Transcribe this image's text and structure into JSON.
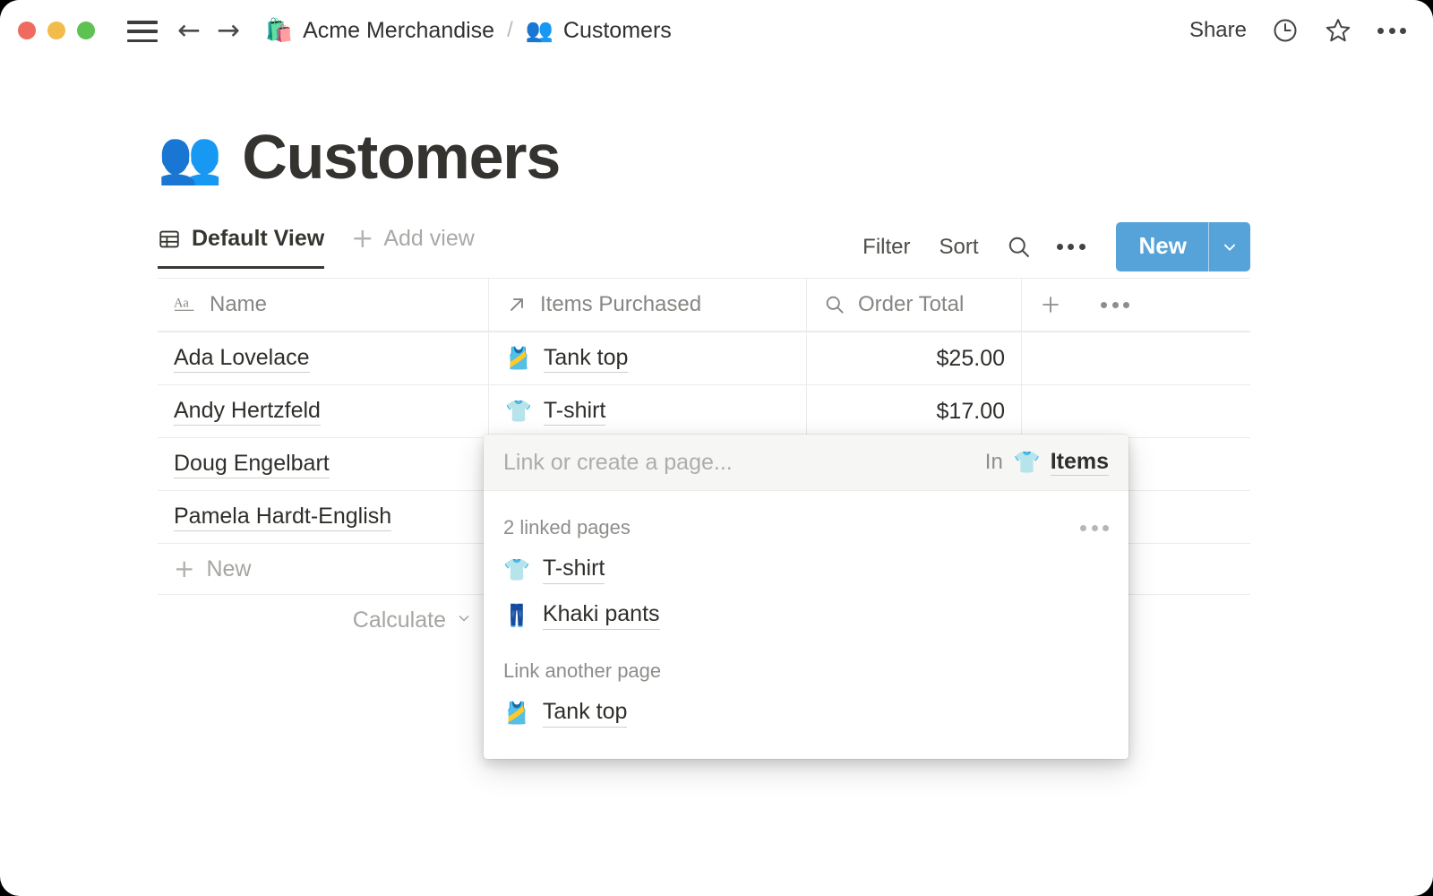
{
  "titlebar": {
    "window_controls": [
      "close",
      "minimize",
      "maximize"
    ],
    "menu_icon": "hamburger-icon",
    "back_arrow": "←",
    "forward_arrow": "→",
    "breadcrumb": {
      "workspace_emoji": "🛍️",
      "workspace": "Acme Merchandise",
      "separator": "/",
      "page_emoji": "👥",
      "page": "Customers"
    },
    "share_label": "Share",
    "history_icon": "clock-icon",
    "favorite_icon": "star-icon",
    "more_icon": "more-horizontal-icon"
  },
  "page": {
    "emoji": "👥",
    "title": "Customers"
  },
  "viewbar": {
    "tabs": [
      {
        "label": "Default View",
        "icon": "table-icon",
        "active": true
      }
    ],
    "add_view_label": "Add view",
    "add_view_icon": "plus-icon",
    "actions": {
      "filter_label": "Filter",
      "sort_label": "Sort",
      "search_icon": "search-icon",
      "more_icon": "more-horizontal-icon",
      "new_label": "New",
      "new_caret_icon": "chevron-down-icon"
    }
  },
  "table": {
    "columns": [
      {
        "label": "Name",
        "icon": "text-type-icon"
      },
      {
        "label": "Items Purchased",
        "icon": "relation-arrow-icon"
      },
      {
        "label": "Order Total",
        "icon": "rollup-search-icon"
      }
    ],
    "add_column_icon": "plus-icon",
    "column_options_icon": "more-horizontal-icon",
    "rows": [
      {
        "name": "Ada Lovelace",
        "item_emoji": "🎽",
        "item": "Tank top",
        "total": "$25.00"
      },
      {
        "name": "Andy Hertzfeld",
        "item_emoji": "👕",
        "item": "T-shirt",
        "total": "$17.00"
      },
      {
        "name": "Doug Engelbart",
        "item_emoji": "",
        "item": "",
        "total": ""
      },
      {
        "name": "Pamela Hardt-English",
        "item_emoji": "",
        "item": "",
        "total": ""
      }
    ],
    "new_row_label": "New",
    "new_row_icon": "plus-icon",
    "calculate_label": "Calculate",
    "calculate_icon": "chevron-down-icon"
  },
  "popup": {
    "input_placeholder": "Link or create a page...",
    "in_label": "In",
    "in_emoji": "👕",
    "in_database": "Items",
    "linked_section": {
      "title": "2 linked pages",
      "more_icon": "more-horizontal-icon",
      "items": [
        {
          "emoji": "👕",
          "label": "T-shirt"
        },
        {
          "emoji": "👖",
          "label": "Khaki pants"
        }
      ]
    },
    "other_section": {
      "title": "Link another page",
      "items": [
        {
          "emoji": "🎽",
          "label": "Tank top"
        }
      ]
    }
  },
  "colors": {
    "accent_blue": "#55a3d9",
    "text_primary": "#2e2e2b",
    "text_muted": "#a5a5a1",
    "border": "#ececeb"
  }
}
